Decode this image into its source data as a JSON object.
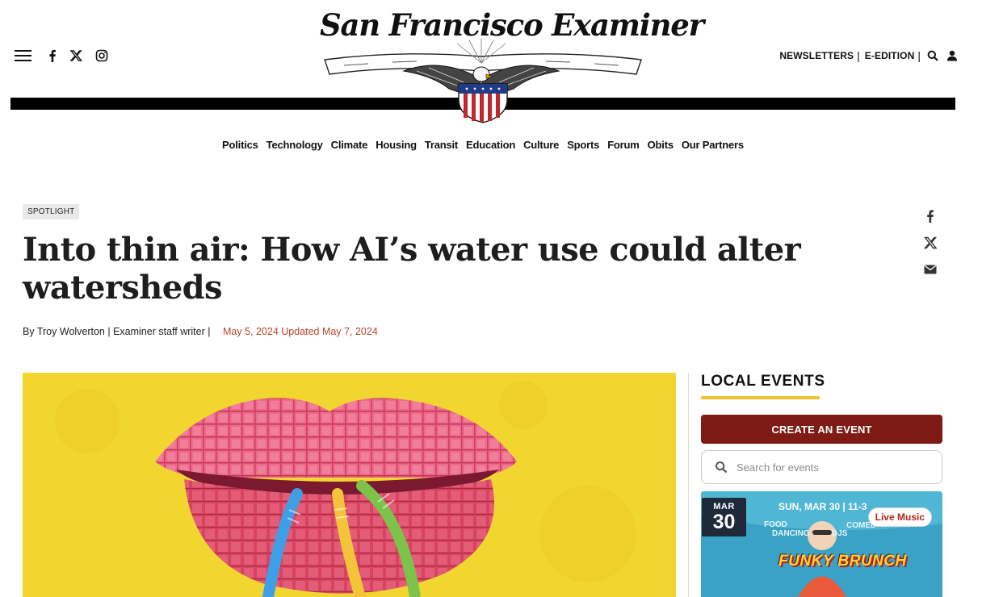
{
  "header": {
    "masthead_title": "San Francisco Examiner",
    "newsletters": "NEWSLETTERS",
    "e_edition": "E-EDITION",
    "separator": "|",
    "social_icons": [
      "facebook-icon",
      "x-twitter-icon",
      "instagram-icon"
    ],
    "utility_icons": [
      "search-icon",
      "user-icon"
    ]
  },
  "nav": {
    "items": [
      "Politics",
      "Technology",
      "Climate",
      "Housing",
      "Transit",
      "Education",
      "Culture",
      "Sports",
      "Forum",
      "Obits",
      "Our Partners"
    ]
  },
  "article": {
    "tag": "SPOTLIGHT",
    "headline": "Into thin air: How AI’s water use could alter watersheds",
    "byline": "By Troy Wolverton | Examiner staff writer |",
    "dates": "May 5, 2024 Updated May 7, 2024",
    "share_icons": [
      "facebook-icon",
      "x-twitter-icon",
      "envelope-icon"
    ]
  },
  "sidebar": {
    "title": "LOCAL EVENTS",
    "create_label": "CREATE AN EVENT",
    "search_placeholder": "Search for events",
    "event": {
      "month": "MAR",
      "day": "30",
      "category": "Live Music",
      "banner_text": "SUN, MAR 30 | 11-3",
      "food": "FOOD",
      "dancing": "DANCING",
      "djs": "DJS",
      "comedy": "COMED",
      "name": "FUNKY BRUNCH"
    }
  },
  "colors": {
    "accent_red": "#7e1b14",
    "date_red": "#b8452c",
    "underline_gold": "#f1c232",
    "hero_yellow": "#f2d630"
  }
}
